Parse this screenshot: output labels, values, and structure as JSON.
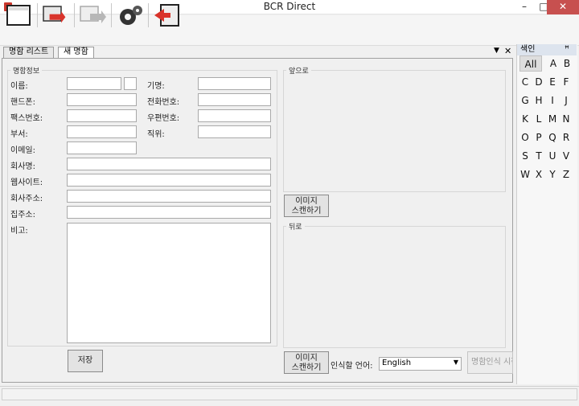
{
  "window": {
    "title": "BCR Direct",
    "minimize": "–",
    "maximize": "□",
    "close": "✕"
  },
  "toolbar": {
    "icons": [
      "new-card-icon",
      "export-icon",
      "import-icon",
      "settings-icon",
      "exit-icon"
    ]
  },
  "tabs": [
    {
      "label": "명함 리스트"
    },
    {
      "label": "새 명함"
    }
  ],
  "tab_menu": "▼",
  "tab_close": "✕",
  "form": {
    "group_title": "명함정보",
    "name_label": "이름:",
    "company_label": "기명:",
    "mobile_label": "핸드폰:",
    "phone_label": "전화번호:",
    "fax_label": "팩스번호:",
    "zip_label": "우편번호:",
    "dept_label": "부서:",
    "position_label": "직위:",
    "email_label": "이메일:",
    "company_name_label": "회사명:",
    "website_label": "웹사이트:",
    "company_address_label": "회사주소:",
    "home_address_label": "집주소:",
    "memo_label": "비고:",
    "save_button": "저장"
  },
  "scan": {
    "front_title": "앞으로",
    "back_title": "뒤로",
    "scan_button_line1": "이미지",
    "scan_button_line2": "스캔하기",
    "language_label": "인식할 언어:",
    "language_value": "English",
    "recognize_button": "명함인식 시작"
  },
  "index": {
    "title": "색인",
    "pin": "ꟸ",
    "letters": [
      "All",
      "A",
      "B",
      "C",
      "D",
      "E",
      "F",
      "G",
      "H",
      "I",
      "J",
      "K",
      "L",
      "M",
      "N",
      "O",
      "P",
      "Q",
      "R",
      "S",
      "T",
      "U",
      "V",
      "W",
      "X",
      "Y",
      "Z"
    ]
  }
}
